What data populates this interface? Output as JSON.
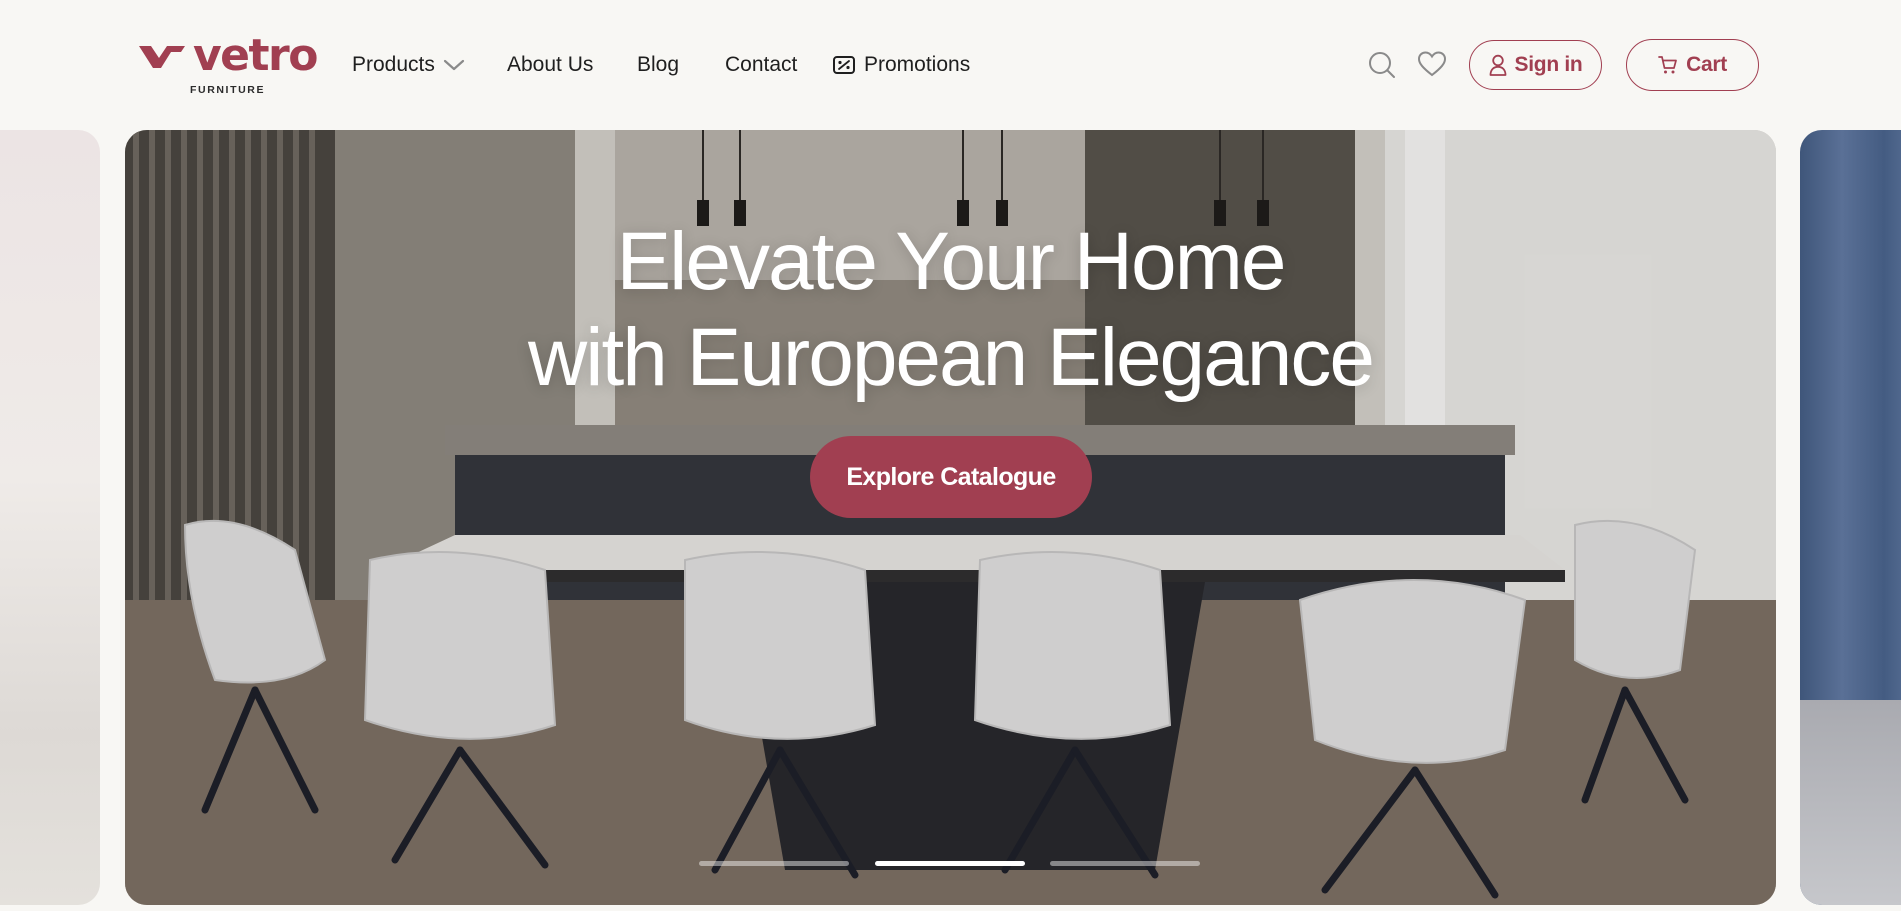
{
  "brand": {
    "name": "vetro",
    "tagline": "FURNITURE",
    "color": "#a13f51"
  },
  "nav": {
    "products": "Products",
    "about": "About Us",
    "blog": "Blog",
    "contact": "Contact",
    "promotions": "Promotions"
  },
  "icons": {
    "search": "search-icon",
    "wishlist": "heart-icon",
    "user": "user-icon",
    "cart": "cart-icon",
    "promo": "ticket-icon",
    "dropdown": "chevron-down-icon"
  },
  "actions": {
    "sign_in": "Sign in",
    "cart": "Cart"
  },
  "hero": {
    "title_line1": "Elevate Your Home",
    "title_line2": "with European Elegance",
    "cta_label": "Explore Catalogue",
    "slide_count": 3,
    "active_slide": 2
  }
}
